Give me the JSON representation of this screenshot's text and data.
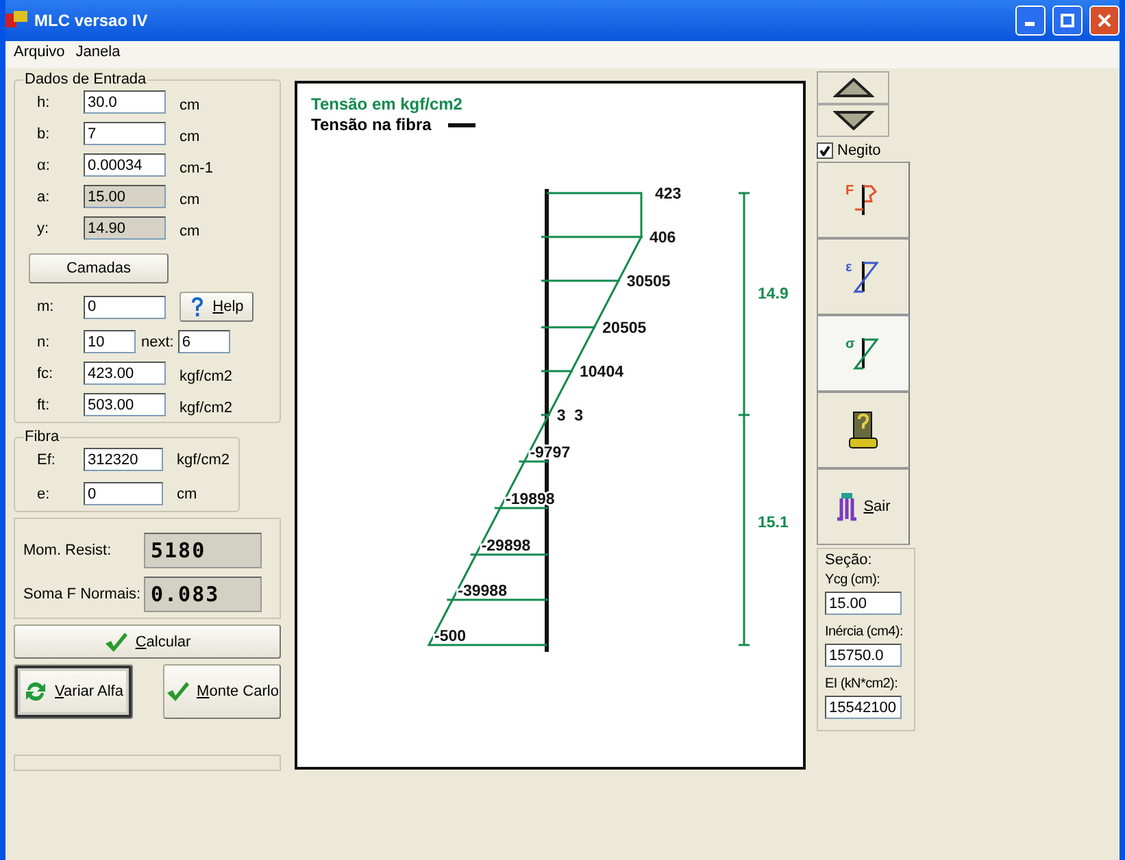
{
  "window": {
    "title": "MLC versao IV"
  },
  "menu": [
    "Arquivo",
    "Janela"
  ],
  "input_group": {
    "title": "Dados de Entrada",
    "rows": [
      {
        "kind": "field",
        "label": "h:",
        "value": "30.0",
        "unit": "cm",
        "readonly": false
      },
      {
        "kind": "field",
        "label": "b:",
        "value": "7",
        "unit": "cm",
        "readonly": false
      },
      {
        "kind": "field",
        "label": "α:",
        "value": "0.00034",
        "unit": "cm-1",
        "readonly": false
      },
      {
        "kind": "field",
        "label": "a:",
        "value": "15.00",
        "unit": "cm",
        "readonly": true
      },
      {
        "kind": "field",
        "label": "y:",
        "value": "14.90",
        "unit": "cm",
        "readonly": true
      },
      {
        "kind": "button",
        "label": "Camadas"
      },
      {
        "kind": "field_help",
        "label": "m:",
        "value": "0",
        "button": "Help"
      },
      {
        "kind": "field_next",
        "label": "n:",
        "value": "10",
        "next_label": "next:",
        "next_value": "6"
      },
      {
        "kind": "field",
        "label": "fc:",
        "value": "423.00",
        "unit": "kgf/cm2",
        "readonly": false
      },
      {
        "kind": "field",
        "label": "ft:",
        "value": "503.00",
        "unit": "kgf/cm2",
        "readonly": false
      }
    ]
  },
  "fiber_group": {
    "title": "Fibra",
    "rows": [
      {
        "label": "Ef:",
        "value": "312320",
        "unit": "kgf/cm2"
      },
      {
        "label": "e:",
        "value": "0",
        "unit": "cm"
      }
    ]
  },
  "results": [
    {
      "label": "Mom. Resist:",
      "value": "5180"
    },
    {
      "label": "Soma F Normais:",
      "value": "0.083"
    }
  ],
  "calculate": {
    "label": "Calcular"
  },
  "actions": [
    {
      "label": "Variar Alfa",
      "focused": true
    },
    {
      "label": "Monte Carlo",
      "focused": false
    }
  ],
  "diagram": {
    "title": "Tensão em kgf/cm2",
    "legend": "Tensão na fibra",
    "levels": [
      "423",
      "406",
      "30505",
      "20505",
      "10404",
      "3  3",
      "-9797",
      "-19898",
      "-29898",
      "-39988",
      "-500"
    ],
    "scale": [
      "14.9",
      "15.1"
    ]
  },
  "sidebar": {
    "bold": {
      "label": "Negito",
      "checked": true
    },
    "tools": [
      {
        "kind": "force",
        "symbol": "F",
        "selected": false
      },
      {
        "kind": "strain",
        "symbol": "ε",
        "selected": false
      },
      {
        "kind": "stress",
        "symbol": "σ",
        "selected": true
      },
      {
        "kind": "help",
        "selected": false
      },
      {
        "kind": "exit",
        "label": "Sair",
        "selected": false
      }
    ],
    "section": {
      "title": "Seção:",
      "fields": [
        {
          "label": "Ycg (cm):",
          "value": "15.00"
        },
        {
          "label": "Inércia (cm4):",
          "value": "15750.0"
        },
        {
          "label": "EI (kN*cm2):",
          "value": "15542100"
        }
      ]
    }
  }
}
